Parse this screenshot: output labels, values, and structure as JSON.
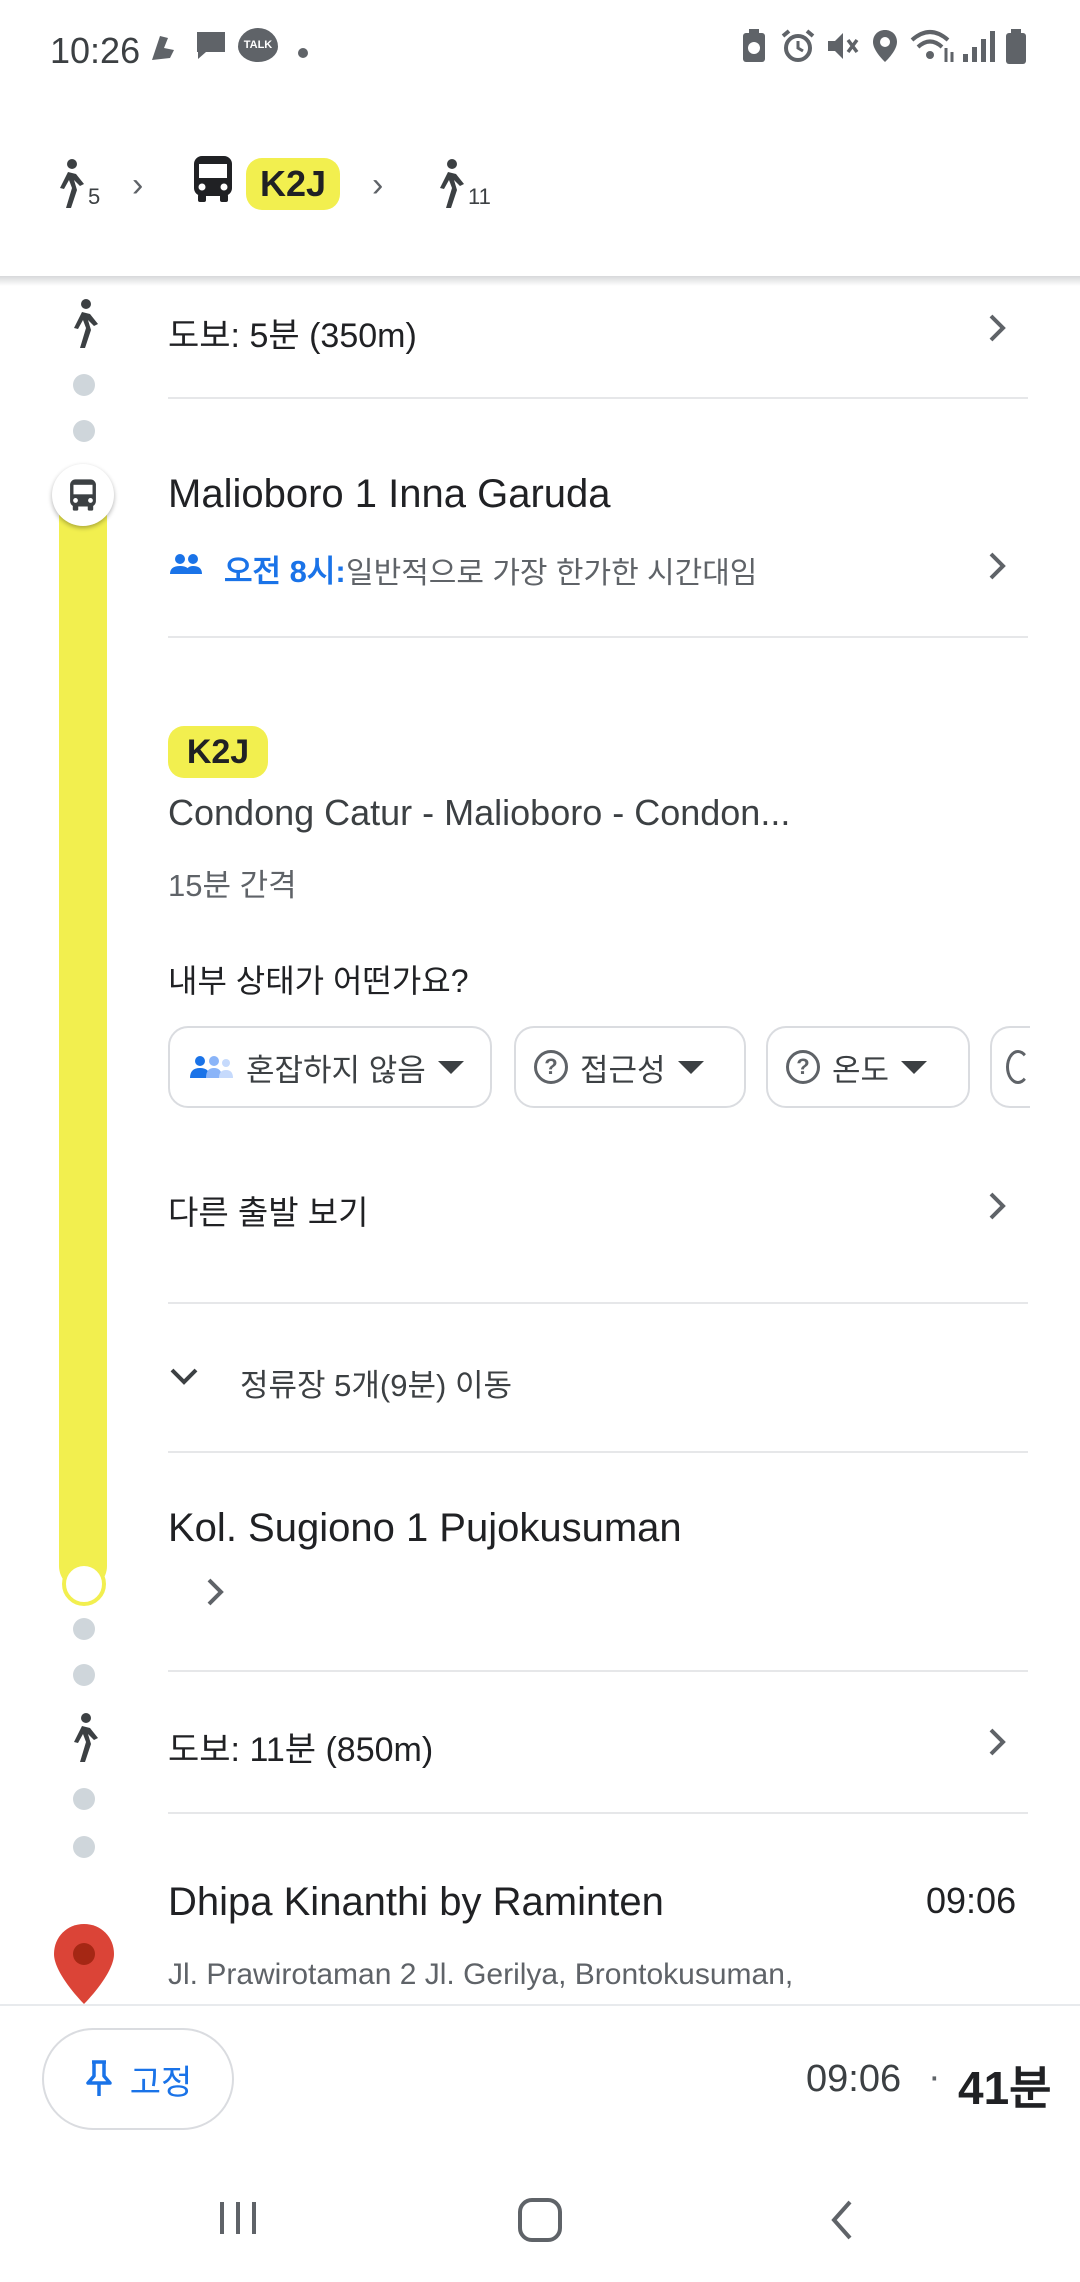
{
  "status_bar": {
    "time": "10:26",
    "left_icons": [
      "fan-notification-icon",
      "message-icon",
      "kakaotalk-icon",
      "dot-icon"
    ],
    "talk_label": "TALK",
    "right_icons": [
      "battery-saver-icon",
      "alarm-icon",
      "mute-icon",
      "location-icon",
      "wifi-icon",
      "signal-icon",
      "battery-icon"
    ]
  },
  "route_summary": {
    "walk1_minutes": "5",
    "line": "K2J",
    "walk2_minutes": "11"
  },
  "timeline": {
    "walk1_text": "도보: 5분 (350m)",
    "board_stop": "Malioboro 1 Inna Garuda",
    "crowd_time": "오전 8시:",
    "crowd_desc": "일반적으로 가장 한가한 시간대임",
    "line_badge": "K2J",
    "route_name": "Condong Catur - Malioboro - Condon...",
    "frequency": "15분 간격",
    "inside_question": "내부 상태가 어떤가요?",
    "chips": [
      {
        "label": "혼잡하지 않음",
        "icon": "people-icon"
      },
      {
        "label": "접근성",
        "icon": "question-icon"
      },
      {
        "label": "온도",
        "icon": "question-icon"
      }
    ],
    "other_departures": "다른 출발 보기",
    "stops_collapsed": "정류장 5개(9분) 이동",
    "alight_stop": "Kol. Sugiono 1 Pujokusuman",
    "walk2_text": "도보: 11분 (850m)",
    "destination_name": "Dhipa Kinanthi by Raminten",
    "destination_time": "09:06",
    "destination_address": "Jl. Prawirotaman 2 Jl. Gerilya, Brontokusuman,"
  },
  "bottom_bar": {
    "pin_label": "고정",
    "arrival_time": "09:06",
    "separator": "·",
    "duration": "41분"
  },
  "colors": {
    "line_yellow": "#f2ef4f",
    "accent_blue": "#1a73e8",
    "destination_red": "#db4437"
  }
}
